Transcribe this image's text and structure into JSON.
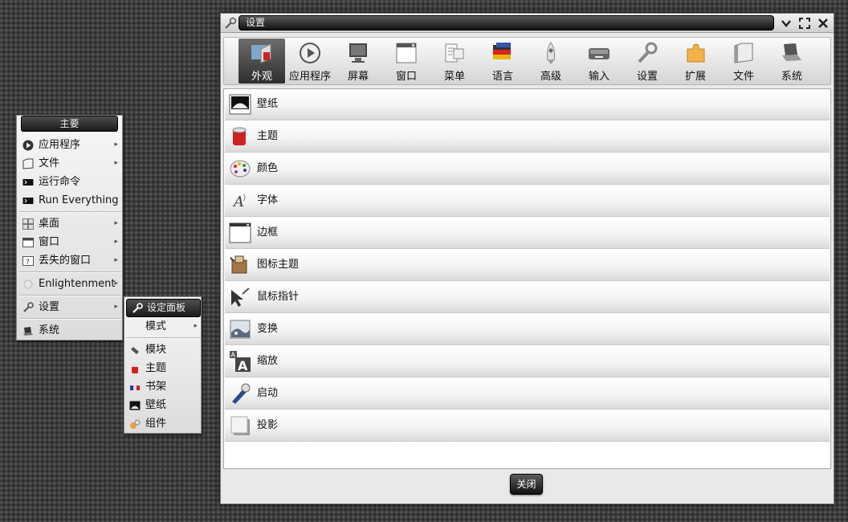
{
  "main_menu": {
    "title": "主要",
    "items": [
      {
        "label": "应用程序",
        "icon": "play-icon",
        "submenu": true
      },
      {
        "label": "文件",
        "icon": "folder-icon",
        "submenu": true
      },
      {
        "label": "运行命令",
        "icon": "terminal-icon",
        "submenu": false
      },
      {
        "label": "Run Everything",
        "icon": "terminal-icon",
        "submenu": false
      },
      {
        "label": "桌面",
        "icon": "desktops-icon",
        "submenu": true
      },
      {
        "label": "窗口",
        "icon": "window-icon",
        "submenu": true
      },
      {
        "label": "丢失的窗口",
        "icon": "lost-window-icon",
        "submenu": true
      },
      {
        "label": "Enlightenment",
        "icon": "enlightenment-icon",
        "submenu": true
      },
      {
        "label": "设置",
        "icon": "wrench-icon",
        "submenu": true
      },
      {
        "label": "系统",
        "icon": "laptop-icon",
        "submenu": false
      }
    ],
    "arrow": "▸"
  },
  "sub_menu": {
    "title": "设定面板",
    "items": [
      {
        "label": "模式",
        "submenu": true
      },
      {
        "label": "模块",
        "icon": "module-icon"
      },
      {
        "label": "主题",
        "icon": "paint-bucket-icon"
      },
      {
        "label": "书架",
        "icon": "shelf-icon"
      },
      {
        "label": "壁纸",
        "icon": "wallpaper-icon"
      },
      {
        "label": "组件",
        "icon": "gadgets-icon"
      }
    ]
  },
  "dialog": {
    "title": "设置",
    "toolbar": [
      {
        "label": "外观",
        "icon": "appearance-icon",
        "active": true
      },
      {
        "label": "应用程序",
        "icon": "play-icon",
        "active": false
      },
      {
        "label": "屏幕",
        "icon": "monitor-icon",
        "active": false
      },
      {
        "label": "窗口",
        "icon": "window-icon",
        "active": false
      },
      {
        "label": "菜单",
        "icon": "menu-icon",
        "active": false
      },
      {
        "label": "语言",
        "icon": "flag-icon",
        "active": false
      },
      {
        "label": "高级",
        "icon": "rocket-icon",
        "active": false
      },
      {
        "label": "输入",
        "icon": "mouse-icon",
        "active": false
      },
      {
        "label": "设置",
        "icon": "wrench-icon",
        "active": false
      },
      {
        "label": "扩展",
        "icon": "puzzle-icon",
        "active": false
      },
      {
        "label": "文件",
        "icon": "folder-icon",
        "active": false
      },
      {
        "label": "系统",
        "icon": "laptop-icon",
        "active": false
      }
    ],
    "list": [
      {
        "label": "壁纸",
        "icon": "wallpaper-icon"
      },
      {
        "label": "主题",
        "icon": "paint-bucket-icon"
      },
      {
        "label": "颜色",
        "icon": "palette-icon"
      },
      {
        "label": "字体",
        "icon": "font-icon"
      },
      {
        "label": "边框",
        "icon": "border-icon"
      },
      {
        "label": "图标主题",
        "icon": "icon-theme-icon"
      },
      {
        "label": "鼠标指针",
        "icon": "cursor-icon"
      },
      {
        "label": "变换",
        "icon": "transition-icon"
      },
      {
        "label": "缩放",
        "icon": "scale-icon"
      },
      {
        "label": "启动",
        "icon": "startup-icon"
      },
      {
        "label": "投影",
        "icon": "shadow-icon"
      }
    ],
    "close_label": "关闭"
  }
}
